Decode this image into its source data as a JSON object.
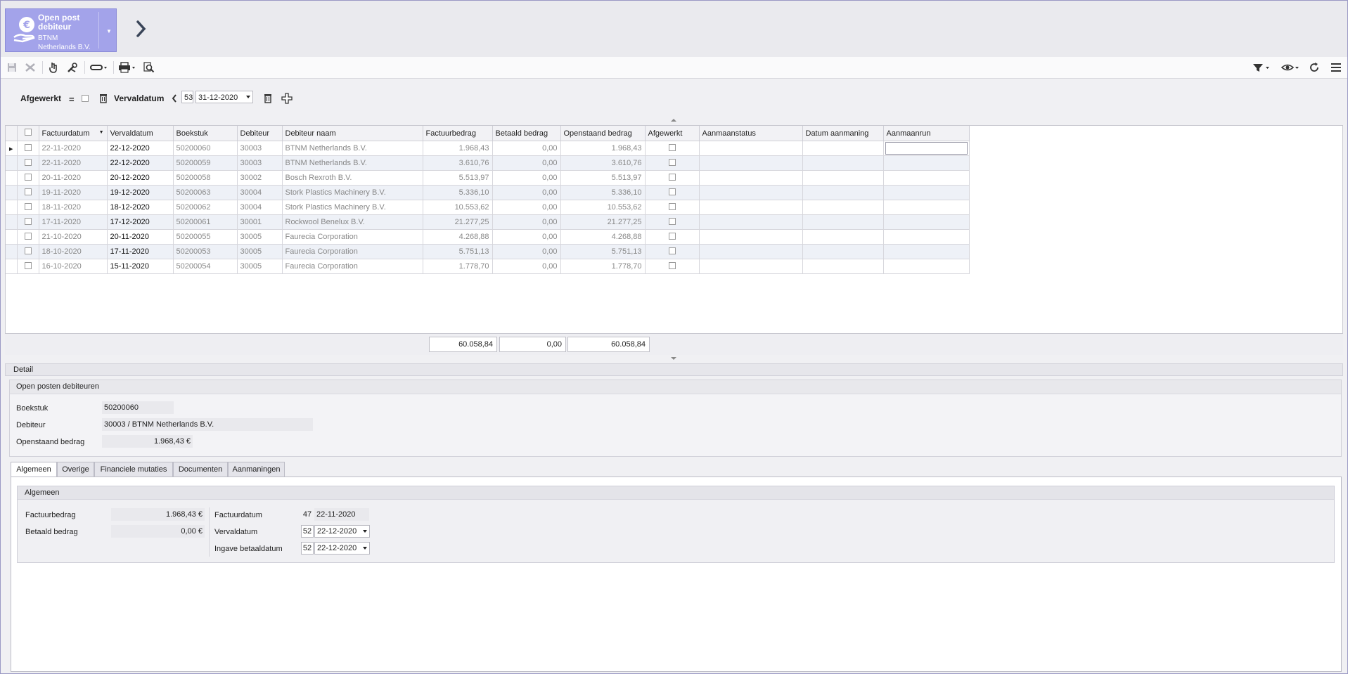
{
  "app": {
    "title_line1": "Open post",
    "title_line2": "debiteur",
    "sub_line1": "BTNM",
    "sub_line2": "Netherlands B.V."
  },
  "filter": {
    "afgewerkt_label": "Afgewerkt",
    "vervaldatum_label": "Vervaldatum",
    "week": "53",
    "date": "31-12-2020"
  },
  "grid": {
    "columns": [
      "Factuurdatum",
      "Vervaldatum",
      "Boekstuk",
      "Debiteur",
      "Debiteur naam",
      "Factuurbedrag",
      "Betaald bedrag",
      "Openstaand bedrag",
      "Afgewerkt",
      "Aanmaanstatus",
      "Datum aanmaning",
      "Aanmaanrun"
    ],
    "rows": [
      {
        "factuurdatum": "22-11-2020",
        "vervaldatum": "22-12-2020",
        "boekstuk": "50200060",
        "debiteur": "30003",
        "naam": "BTNM Netherlands B.V.",
        "factuurbedrag": "1.968,43",
        "betaald": "0,00",
        "openstaand": "1.968,43"
      },
      {
        "factuurdatum": "22-11-2020",
        "vervaldatum": "22-12-2020",
        "boekstuk": "50200059",
        "debiteur": "30003",
        "naam": "BTNM Netherlands B.V.",
        "factuurbedrag": "3.610,76",
        "betaald": "0,00",
        "openstaand": "3.610,76"
      },
      {
        "factuurdatum": "20-11-2020",
        "vervaldatum": "20-12-2020",
        "boekstuk": "50200058",
        "debiteur": "30002",
        "naam": "Bosch Rexroth B.V.",
        "factuurbedrag": "5.513,97",
        "betaald": "0,00",
        "openstaand": "5.513,97"
      },
      {
        "factuurdatum": "19-11-2020",
        "vervaldatum": "19-12-2020",
        "boekstuk": "50200063",
        "debiteur": "30004",
        "naam": "Stork Plastics Machinery B.V.",
        "factuurbedrag": "5.336,10",
        "betaald": "0,00",
        "openstaand": "5.336,10"
      },
      {
        "factuurdatum": "18-11-2020",
        "vervaldatum": "18-12-2020",
        "boekstuk": "50200062",
        "debiteur": "30004",
        "naam": "Stork Plastics Machinery B.V.",
        "factuurbedrag": "10.553,62",
        "betaald": "0,00",
        "openstaand": "10.553,62"
      },
      {
        "factuurdatum": "17-11-2020",
        "vervaldatum": "17-12-2020",
        "boekstuk": "50200061",
        "debiteur": "30001",
        "naam": "Rockwool Benelux B.V.",
        "factuurbedrag": "21.277,25",
        "betaald": "0,00",
        "openstaand": "21.277,25"
      },
      {
        "factuurdatum": "21-10-2020",
        "vervaldatum": "20-11-2020",
        "boekstuk": "50200055",
        "debiteur": "30005",
        "naam": "Faurecia Corporation",
        "factuurbedrag": "4.268,88",
        "betaald": "0,00",
        "openstaand": "4.268,88"
      },
      {
        "factuurdatum": "18-10-2020",
        "vervaldatum": "17-11-2020",
        "boekstuk": "50200053",
        "debiteur": "30005",
        "naam": "Faurecia Corporation",
        "factuurbedrag": "5.751,13",
        "betaald": "0,00",
        "openstaand": "5.751,13"
      },
      {
        "factuurdatum": "16-10-2020",
        "vervaldatum": "15-11-2020",
        "boekstuk": "50200054",
        "debiteur": "30005",
        "naam": "Faurecia Corporation",
        "factuurbedrag": "1.778,70",
        "betaald": "0,00",
        "openstaand": "1.778,70"
      }
    ],
    "totals": {
      "factuurbedrag": "60.058,84",
      "betaald": "0,00",
      "openstaand": "60.058,84"
    }
  },
  "detail": {
    "header": "Detail",
    "panel_title": "Open posten debiteuren",
    "boekstuk_label": "Boekstuk",
    "boekstuk_value": "50200060",
    "debiteur_label": "Debiteur",
    "debiteur_value": "30003 / BTNM Netherlands B.V.",
    "openstaand_label": "Openstaand bedrag",
    "openstaand_value": "1.968,43 €"
  },
  "tabs": [
    "Algemeen",
    "Overige",
    "Financiele mutaties",
    "Documenten",
    "Aanmaningen"
  ],
  "algemeen": {
    "title": "Algemeen",
    "factuurbedrag_label": "Factuurbedrag",
    "factuurbedrag_value": "1.968,43 €",
    "betaald_label": "Betaald bedrag",
    "betaald_value": "0,00 €",
    "factuurdatum_label": "Factuurdatum",
    "factuurdatum_week": "47",
    "factuurdatum_value": "22-11-2020",
    "vervaldatum_label": "Vervaldatum",
    "vervaldatum_week": "52",
    "vervaldatum_value": "22-12-2020",
    "ingave_label": "Ingave betaaldatum",
    "ingave_week": "52",
    "ingave_value": "22-12-2020"
  },
  "colors": {
    "accent": "#a3a3ea",
    "row_alt": "#eef1f7",
    "frame": "#9a98c4"
  },
  "icons": [
    "euro-hand-icon",
    "chevron-right-icon",
    "save-icon",
    "cancel-icon",
    "hand-icon",
    "tools-icon",
    "link-icon",
    "print-icon",
    "preview-icon",
    "filter-icon",
    "view-icon",
    "refresh-icon",
    "menu-icon",
    "trash-icon",
    "add-icon",
    "chevron-left-icon"
  ]
}
